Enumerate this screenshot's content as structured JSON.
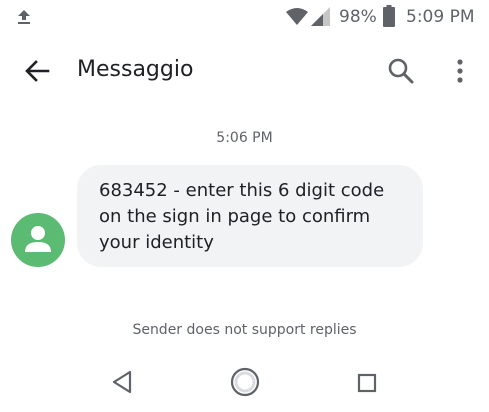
{
  "status_bar": {
    "battery_percent": "98%",
    "time": "5:09 PM",
    "icons": [
      "upload-icon",
      "wifi-icon",
      "signal-icon",
      "battery-icon"
    ]
  },
  "app_bar": {
    "title": "Messaggio",
    "icons": [
      "back-arrow-icon",
      "search-icon",
      "more-vert-icon"
    ]
  },
  "conversation": {
    "timestamp": "5:06 PM",
    "message": {
      "text": "683452 - enter this 6 digit code on the sign in page to confirm your identity",
      "avatar_color": "#5cbb73",
      "bubble_color": "#f1f3f4"
    },
    "footer_note": "Sender does not support replies"
  },
  "nav_bar": {
    "icons": [
      "nav-back-icon",
      "nav-home-icon",
      "nav-recents-icon"
    ]
  }
}
